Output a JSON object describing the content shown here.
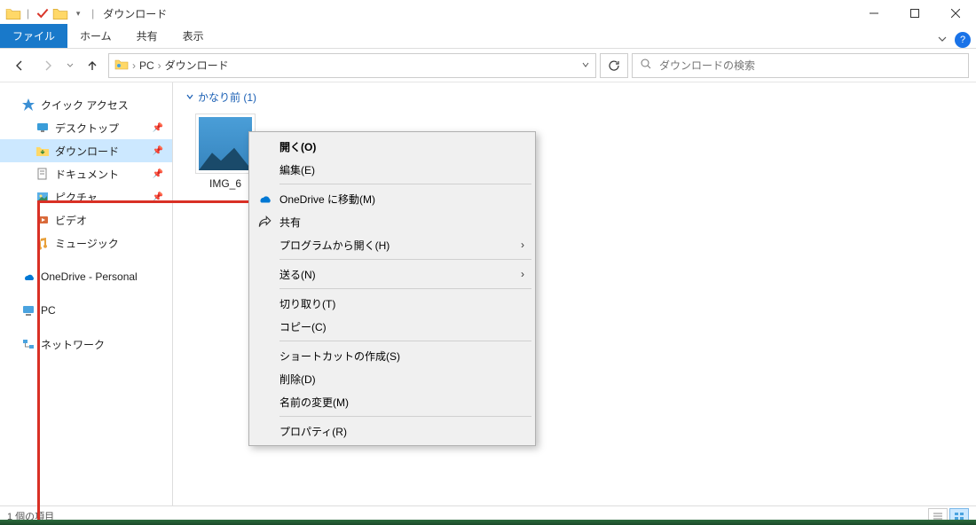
{
  "titlebar": {
    "title": "ダウンロード"
  },
  "ribbon": {
    "file": "ファイル",
    "home": "ホーム",
    "share": "共有",
    "view": "表示"
  },
  "address": {
    "crumbs": [
      "PC",
      "ダウンロード"
    ]
  },
  "search": {
    "placeholder": "ダウンロードの検索"
  },
  "sidebar": {
    "quick_access": "クイック アクセス",
    "items": [
      {
        "label": "デスクトップ",
        "pinned": true
      },
      {
        "label": "ダウンロード",
        "pinned": true,
        "selected": true
      },
      {
        "label": "ドキュメント",
        "pinned": true
      },
      {
        "label": "ピクチャ",
        "pinned": true
      },
      {
        "label": "ビデオ",
        "pinned": false
      },
      {
        "label": "ミュージック",
        "pinned": false
      }
    ],
    "onedrive": "OneDrive - Personal",
    "pc": "PC",
    "network": "ネットワーク"
  },
  "content": {
    "group_label": "かなり前 (1)",
    "file_name": "IMG_6"
  },
  "context_menu": {
    "open": "開く(O)",
    "edit": "編集(E)",
    "onedrive_move": "OneDrive に移動(M)",
    "share": "共有",
    "open_with": "プログラムから開く(H)",
    "send_to": "送る(N)",
    "cut": "切り取り(T)",
    "copy": "コピー(C)",
    "create_shortcut": "ショートカットの作成(S)",
    "delete": "削除(D)",
    "rename": "名前の変更(M)",
    "properties": "プロパティ(R)"
  },
  "statusbar": {
    "item_count": "1 個の項目"
  }
}
